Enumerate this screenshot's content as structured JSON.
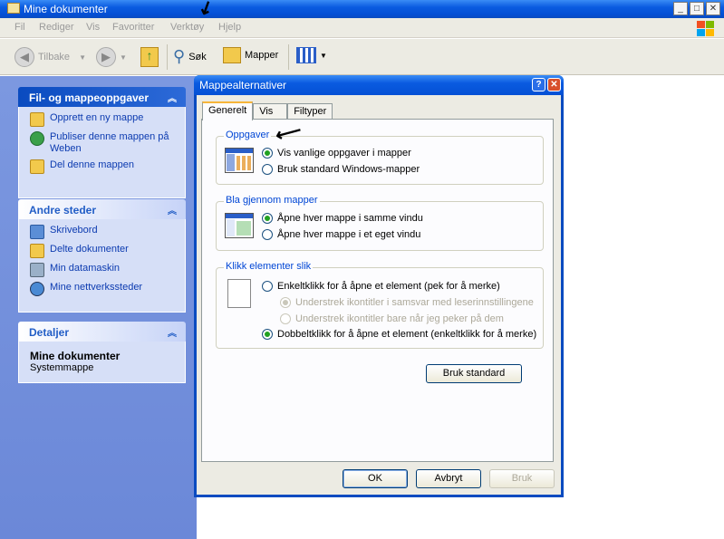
{
  "window": {
    "title": "Mine dokumenter"
  },
  "menu": [
    "Fil",
    "Rediger",
    "Vis",
    "Favoritter",
    "Verktøy",
    "Hjelp"
  ],
  "toolbar": {
    "back": "Tilbake",
    "search": "Søk",
    "folders": "Mapper"
  },
  "tasks_panel": {
    "title": "Fil- og mappeoppgaver",
    "items": [
      "Opprett en ny mappe",
      "Publiser denne mappen på Weben",
      "Del denne mappen"
    ]
  },
  "places_panel": {
    "title": "Andre steder",
    "items": [
      "Skrivebord",
      "Delte dokumenter",
      "Min datamaskin",
      "Mine nettverkssteder"
    ]
  },
  "details_panel": {
    "title": "Detaljer",
    "name": "Mine dokumenter",
    "type": "Systemmappe"
  },
  "dialog": {
    "title": "Mappealternativer",
    "tabs": [
      "Generelt",
      "Vis",
      "Filtyper"
    ],
    "groups": {
      "tasks": {
        "legend": "Oppgaver",
        "options": [
          "Vis vanlige oppgaver i mapper",
          "Bruk standard Windows-mapper"
        ],
        "selected": 0
      },
      "browse": {
        "legend": "Bla gjennom mapper",
        "options": [
          "Åpne hver mappe i samme vindu",
          "Åpne hver mappe i et eget vindu"
        ],
        "selected": 0
      },
      "click": {
        "legend": "Klikk elementer slik",
        "single": "Enkeltklikk for å åpne et element (pek for å merke)",
        "sub1": "Understrek ikontitler i samsvar med leserinnstillingene",
        "sub2": "Understrek ikontitler bare når jeg peker på dem",
        "double": "Dobbeltklikk for å åpne et element (enkeltklikk for å merke)",
        "selected": "double"
      }
    },
    "restore_defaults": "Bruk standard",
    "ok": "OK",
    "cancel": "Avbryt",
    "apply": "Bruk"
  }
}
